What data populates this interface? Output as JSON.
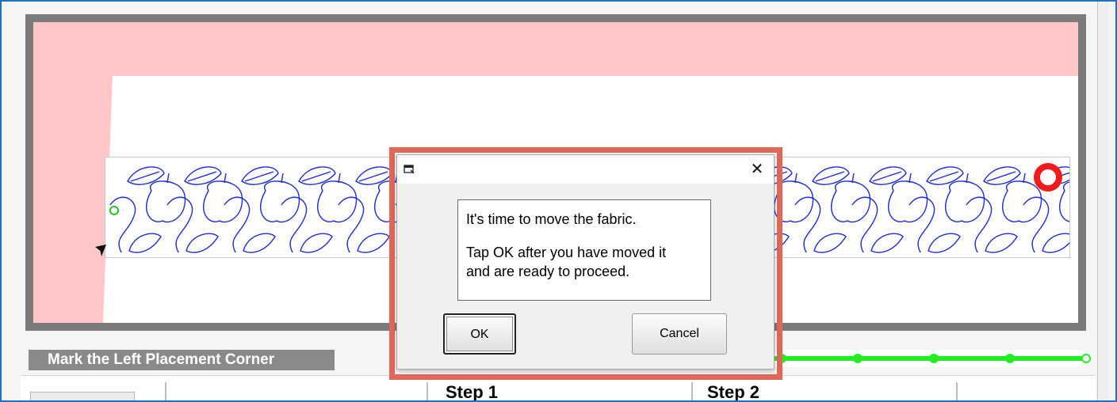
{
  "status": {
    "label": "Mark the Left Placement Corner"
  },
  "steps": {
    "step1_label": "Step 1",
    "step2_label": "Step 2"
  },
  "progress": {
    "nodes": 5,
    "completed": 4
  },
  "dialog": {
    "close_glyph": "✕",
    "message_line1": "It's time to move the fabric.",
    "message_line2": "Tap OK after you have moved it",
    "message_line3": "and are ready to proceed.",
    "ok_label": "OK",
    "cancel_label": "Cancel"
  },
  "colors": {
    "highlight": "#e0685a",
    "pattern_stroke": "#1f2bd6",
    "start_marker": "#22c322",
    "end_marker": "#ee1c1c",
    "progress": "#22ee22",
    "pink_margin": "#ffc7c7"
  },
  "icons": {
    "dialog_icon": "window-icon",
    "pointer": "arrow-pointer-icon"
  }
}
